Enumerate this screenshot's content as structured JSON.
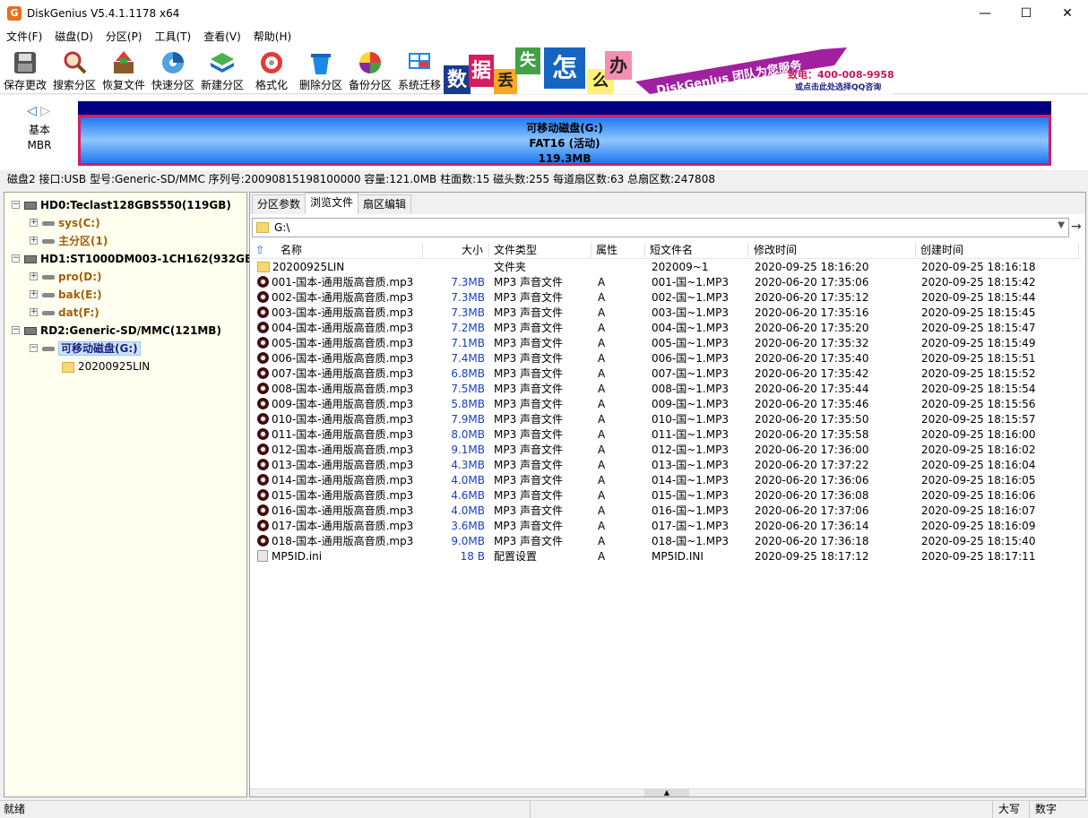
{
  "window": {
    "title": "DiskGenius V5.4.1.1178 x64",
    "app_icon_letter": "G",
    "minimize": "—",
    "maximize": "☐",
    "close": "✕"
  },
  "menu": [
    "文件(F)",
    "磁盘(D)",
    "分区(P)",
    "工具(T)",
    "查看(V)",
    "帮助(H)"
  ],
  "toolbar": [
    {
      "label": "保存更改",
      "icon": "save-icon"
    },
    {
      "label": "搜索分区",
      "icon": "search-icon"
    },
    {
      "label": "恢复文件",
      "icon": "recover-icon"
    },
    {
      "label": "快速分区",
      "icon": "quick-partition-icon"
    },
    {
      "label": "新建分区",
      "icon": "new-partition-icon"
    },
    {
      "label": "格式化",
      "icon": "format-icon"
    },
    {
      "label": "删除分区",
      "icon": "delete-icon"
    },
    {
      "label": "备份分区",
      "icon": "backup-icon"
    },
    {
      "label": "系统迁移",
      "icon": "migrate-icon"
    }
  ],
  "banner": {
    "chars": [
      "数",
      "据",
      "丢",
      "失",
      "怎",
      "么",
      "办"
    ],
    "slogan": "DiskGenius 团队为您服务",
    "phone": "致电：400-008-9958",
    "qq": "或点击此处选择QQ咨询"
  },
  "diskmap": {
    "nav_left": "◁",
    "nav_right": "▷",
    "type_line1": "基本",
    "type_line2": "MBR",
    "partition_name": "可移动磁盘(G:)",
    "partition_fs": "FAT16 (活动)",
    "partition_size": "119.3MB"
  },
  "disk_info": "磁盘2 接口:USB  型号:Generic-SD/MMC  序列号:20090815198100000  容量:121.0MB  柱面数:15  磁头数:255  每道扇区数:63  总扇区数:247808",
  "tree": {
    "hd0": "HD0:Teclast128GBS550(119GB)",
    "hd0_parts": [
      "sys(C:)",
      "主分区(1)"
    ],
    "hd1": "HD1:ST1000DM003-1CH162(932GB)",
    "hd1_parts": [
      "pro(D:)",
      "bak(E:)",
      "dat(F:)"
    ],
    "rd2": "RD2:Generic-SD/MMC(121MB)",
    "rd2_part": "可移动磁盘(G:)",
    "rd2_folder": "20200925LIN"
  },
  "tabs": [
    "分区参数",
    "浏览文件",
    "扇区编辑"
  ],
  "active_tab": "浏览文件",
  "path": "G:\\",
  "columns": {
    "name": "名称",
    "size": "大小",
    "type": "文件类型",
    "attr": "属性",
    "short": "短文件名",
    "modified": "修改时间",
    "created": "创建时间"
  },
  "files": [
    {
      "name": "20200925LIN",
      "size": "",
      "type": "文件夹",
      "attr": "",
      "short": "202009~1",
      "modified": "2020-09-25 18:16:20",
      "created": "2020-09-25 18:16:18",
      "kind": "folder"
    },
    {
      "name": "001-国本-通用版高音质.mp3",
      "size": "7.3MB",
      "type": "MP3 声音文件",
      "attr": "A",
      "short": "001-国~1.MP3",
      "modified": "2020-06-20 17:35:06",
      "created": "2020-09-25 18:15:42",
      "kind": "mp3"
    },
    {
      "name": "002-国本-通用版高音质.mp3",
      "size": "7.3MB",
      "type": "MP3 声音文件",
      "attr": "A",
      "short": "002-国~1.MP3",
      "modified": "2020-06-20 17:35:12",
      "created": "2020-09-25 18:15:44",
      "kind": "mp3"
    },
    {
      "name": "003-国本-通用版高音质.mp3",
      "size": "7.3MB",
      "type": "MP3 声音文件",
      "attr": "A",
      "short": "003-国~1.MP3",
      "modified": "2020-06-20 17:35:16",
      "created": "2020-09-25 18:15:45",
      "kind": "mp3"
    },
    {
      "name": "004-国本-通用版高音质.mp3",
      "size": "7.2MB",
      "type": "MP3 声音文件",
      "attr": "A",
      "short": "004-国~1.MP3",
      "modified": "2020-06-20 17:35:20",
      "created": "2020-09-25 18:15:47",
      "kind": "mp3"
    },
    {
      "name": "005-国本-通用版高音质.mp3",
      "size": "7.1MB",
      "type": "MP3 声音文件",
      "attr": "A",
      "short": "005-国~1.MP3",
      "modified": "2020-06-20 17:35:32",
      "created": "2020-09-25 18:15:49",
      "kind": "mp3"
    },
    {
      "name": "006-国本-通用版高音质.mp3",
      "size": "7.4MB",
      "type": "MP3 声音文件",
      "attr": "A",
      "short": "006-国~1.MP3",
      "modified": "2020-06-20 17:35:40",
      "created": "2020-09-25 18:15:51",
      "kind": "mp3"
    },
    {
      "name": "007-国本-通用版高音质.mp3",
      "size": "6.8MB",
      "type": "MP3 声音文件",
      "attr": "A",
      "short": "007-国~1.MP3",
      "modified": "2020-06-20 17:35:42",
      "created": "2020-09-25 18:15:52",
      "kind": "mp3"
    },
    {
      "name": "008-国本-通用版高音质.mp3",
      "size": "7.5MB",
      "type": "MP3 声音文件",
      "attr": "A",
      "short": "008-国~1.MP3",
      "modified": "2020-06-20 17:35:44",
      "created": "2020-09-25 18:15:54",
      "kind": "mp3"
    },
    {
      "name": "009-国本-通用版高音质.mp3",
      "size": "5.8MB",
      "type": "MP3 声音文件",
      "attr": "A",
      "short": "009-国~1.MP3",
      "modified": "2020-06-20 17:35:46",
      "created": "2020-09-25 18:15:56",
      "kind": "mp3"
    },
    {
      "name": "010-国本-通用版高音质.mp3",
      "size": "7.9MB",
      "type": "MP3 声音文件",
      "attr": "A",
      "short": "010-国~1.MP3",
      "modified": "2020-06-20 17:35:50",
      "created": "2020-09-25 18:15:57",
      "kind": "mp3"
    },
    {
      "name": "011-国本-通用版高音质.mp3",
      "size": "8.0MB",
      "type": "MP3 声音文件",
      "attr": "A",
      "short": "011-国~1.MP3",
      "modified": "2020-06-20 17:35:58",
      "created": "2020-09-25 18:16:00",
      "kind": "mp3"
    },
    {
      "name": "012-国本-通用版高音质.mp3",
      "size": "9.1MB",
      "type": "MP3 声音文件",
      "attr": "A",
      "short": "012-国~1.MP3",
      "modified": "2020-06-20 17:36:00",
      "created": "2020-09-25 18:16:02",
      "kind": "mp3"
    },
    {
      "name": "013-国本-通用版高音质.mp3",
      "size": "4.3MB",
      "type": "MP3 声音文件",
      "attr": "A",
      "short": "013-国~1.MP3",
      "modified": "2020-06-20 17:37:22",
      "created": "2020-09-25 18:16:04",
      "kind": "mp3"
    },
    {
      "name": "014-国本-通用版高音质.mp3",
      "size": "4.0MB",
      "type": "MP3 声音文件",
      "attr": "A",
      "short": "014-国~1.MP3",
      "modified": "2020-06-20 17:36:06",
      "created": "2020-09-25 18:16:05",
      "kind": "mp3"
    },
    {
      "name": "015-国本-通用版高音质.mp3",
      "size": "4.6MB",
      "type": "MP3 声音文件",
      "attr": "A",
      "short": "015-国~1.MP3",
      "modified": "2020-06-20 17:36:08",
      "created": "2020-09-25 18:16:06",
      "kind": "mp3"
    },
    {
      "name": "016-国本-通用版高音质.mp3",
      "size": "4.0MB",
      "type": "MP3 声音文件",
      "attr": "A",
      "short": "016-国~1.MP3",
      "modified": "2020-06-20 17:37:06",
      "created": "2020-09-25 18:16:07",
      "kind": "mp3"
    },
    {
      "name": "017-国本-通用版高音质.mp3",
      "size": "3.6MB",
      "type": "MP3 声音文件",
      "attr": "A",
      "short": "017-国~1.MP3",
      "modified": "2020-06-20 17:36:14",
      "created": "2020-09-25 18:16:09",
      "kind": "mp3"
    },
    {
      "name": "018-国本-通用版高音质.mp3",
      "size": "9.0MB",
      "type": "MP3 声音文件",
      "attr": "A",
      "short": "018-国~1.MP3",
      "modified": "2020-06-20 17:36:18",
      "created": "2020-09-25 18:15:40",
      "kind": "mp3"
    },
    {
      "name": "MP5ID.ini",
      "size": "18 B",
      "type": "配置设置",
      "attr": "A",
      "short": "MP5ID.INI",
      "modified": "2020-09-25 18:17:12",
      "created": "2020-09-25 18:17:11",
      "kind": "ini"
    }
  ],
  "status": {
    "left": "就绪",
    "caps": "大写",
    "num": "数字"
  }
}
